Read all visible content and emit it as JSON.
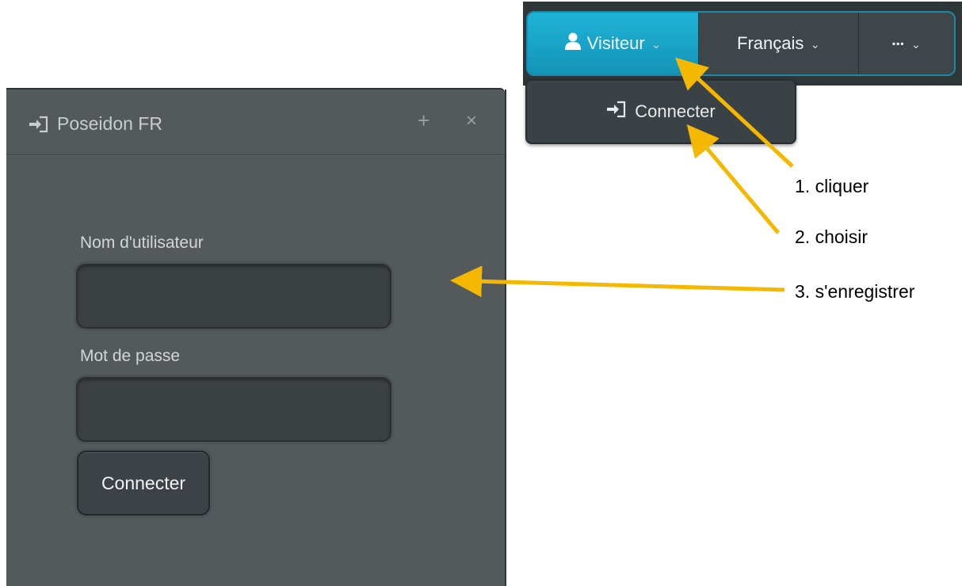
{
  "navbar": {
    "visitor_label": "Visiteur",
    "language_label": "Français",
    "more_label": "▪▪▪"
  },
  "dropdown": {
    "connect_label": "Connecter"
  },
  "panel": {
    "title": "Poseidon FR",
    "plus_label": "+",
    "close_label": "×",
    "username_label": "Nom d'utilisateur",
    "username_value": "",
    "password_label": "Mot de passe",
    "password_value": "",
    "submit_label": "Connecter"
  },
  "annotations": {
    "step1": "1. cliquer",
    "step2": "2. choisir",
    "step3": "3. s'enregistrer",
    "arrow_color": "#f5b800"
  },
  "colors": {
    "accent": "#1aa6cc",
    "panel_bg": "#545a5c",
    "navbar_bg": "#2f3638"
  }
}
